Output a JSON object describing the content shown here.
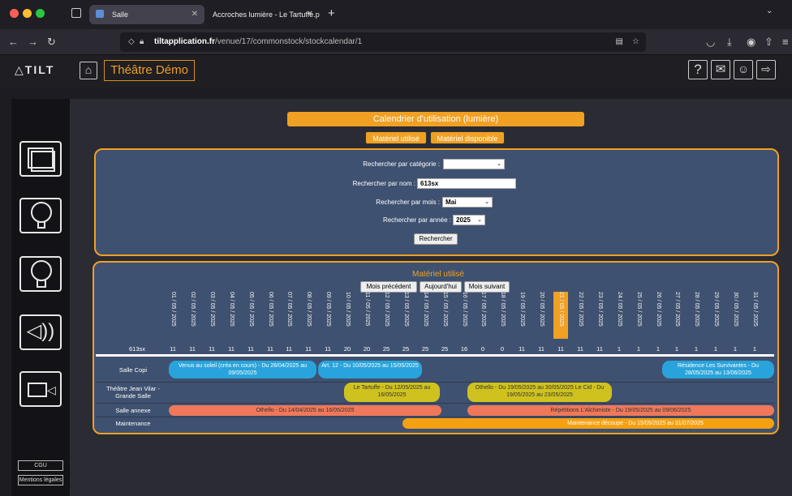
{
  "browser": {
    "tabs": [
      {
        "label": "Salle",
        "active": true
      },
      {
        "label": "Accroches lumière - Le Tartuffe.pdf",
        "active": false
      }
    ],
    "url_host": "tiltapplication.fr",
    "url_path": "/venue/17/commonstock/stockcalendar/1"
  },
  "app": {
    "logo": "TILT",
    "venue": "Théâtre Démo"
  },
  "sidebar": {
    "buttons": [
      "CGU",
      "Mentions légales"
    ]
  },
  "main": {
    "title": "Calendrier d'utilisation (lumière)",
    "tab_used": "Matériel utilisé",
    "tab_available": "Matériel disponible",
    "search": {
      "category_label": "Rechercher par catégorie :",
      "category_value": "",
      "name_label": "Rechercher par nom :",
      "name_value": "613sx",
      "month_label": "Rechercher par mois :",
      "month_value": "Mai",
      "year_label": "Rechercher par année :",
      "year_value": "2025",
      "submit": "Rechercher"
    },
    "calendar": {
      "title": "Matériel utilisé",
      "prev": "Mois précédent",
      "today": "Aujourd'hui",
      "next": "Mois suivant",
      "dates": [
        "01 / 05 / 2025",
        "02 / 05 / 2025",
        "03 / 05 / 2025",
        "04 / 05 / 2025",
        "05 / 05 / 2025",
        "06 / 05 / 2025",
        "07 / 05 / 2025",
        "08 / 05 / 2025",
        "09 / 05 / 2025",
        "10 / 05 / 2025",
        "11 / 05 / 2025",
        "12 / 05 / 2025",
        "13 / 05 / 2025",
        "14 / 05 / 2025",
        "15 / 05 / 2025",
        "16 / 05 / 2025",
        "17 / 05 / 2025",
        "18 / 05 / 2025",
        "19 / 05 / 2025",
        "20 / 05 / 2025",
        "21 / 05 / 2025",
        "22 / 05 / 2025",
        "23 / 05 / 2025",
        "24 / 05 / 2025",
        "25 / 05 / 2025",
        "26 / 05 / 2025",
        "27 / 05 / 2025",
        "28 / 05 / 2025",
        "29 / 05 / 2025",
        "30 / 05 / 2025",
        "31 / 05 / 2025"
      ],
      "today_index": 20,
      "item_label": "613sx",
      "counts": [
        "11",
        "11",
        "11",
        "11",
        "11",
        "11",
        "11",
        "11",
        "11",
        "20",
        "20",
        "25",
        "25",
        "25",
        "25",
        "16",
        "0",
        "0",
        "11",
        "11",
        "11",
        "11",
        "11",
        "1",
        "1",
        "1",
        "1",
        "1",
        "1",
        "1",
        "1"
      ],
      "rooms": [
        "Salle Copi",
        "Théâtre Jean Vilar - Grande Salle",
        "Salle annexe",
        "Maintenance"
      ],
      "events": [
        {
          "text": "Venus au soleil (créa en cours) - Du 28/04/2025 au 09/05/2025",
          "color": "blue"
        },
        {
          "text": "Art. 12 - Du 10/05/2025 au 15/05/2025",
          "color": "blue"
        },
        {
          "text": "Résidence Les Survivantes - Du 28/05/2025 au 13/06/2025",
          "color": "blue"
        },
        {
          "text": "Le Tartuffe - Du 12/05/2025 au 16/05/2025",
          "color": "yellow"
        },
        {
          "text": "Othello - Du 19/05/2025 au 30/05/2025 Le Cid - Du 19/05/2025 au 23/05/2025",
          "color": "yellow"
        },
        {
          "text": "Othello - Du 14/04/2025 au 16/05/2025",
          "color": "salmon"
        },
        {
          "text": "Répétitions L'Alchimiste - Du 19/05/2025 au 09/06/2025",
          "color": "salmon"
        },
        {
          "text": "Maintenance découpe - Du 15/05/2025 au 31/07/2025",
          "color": "orange"
        }
      ]
    }
  }
}
